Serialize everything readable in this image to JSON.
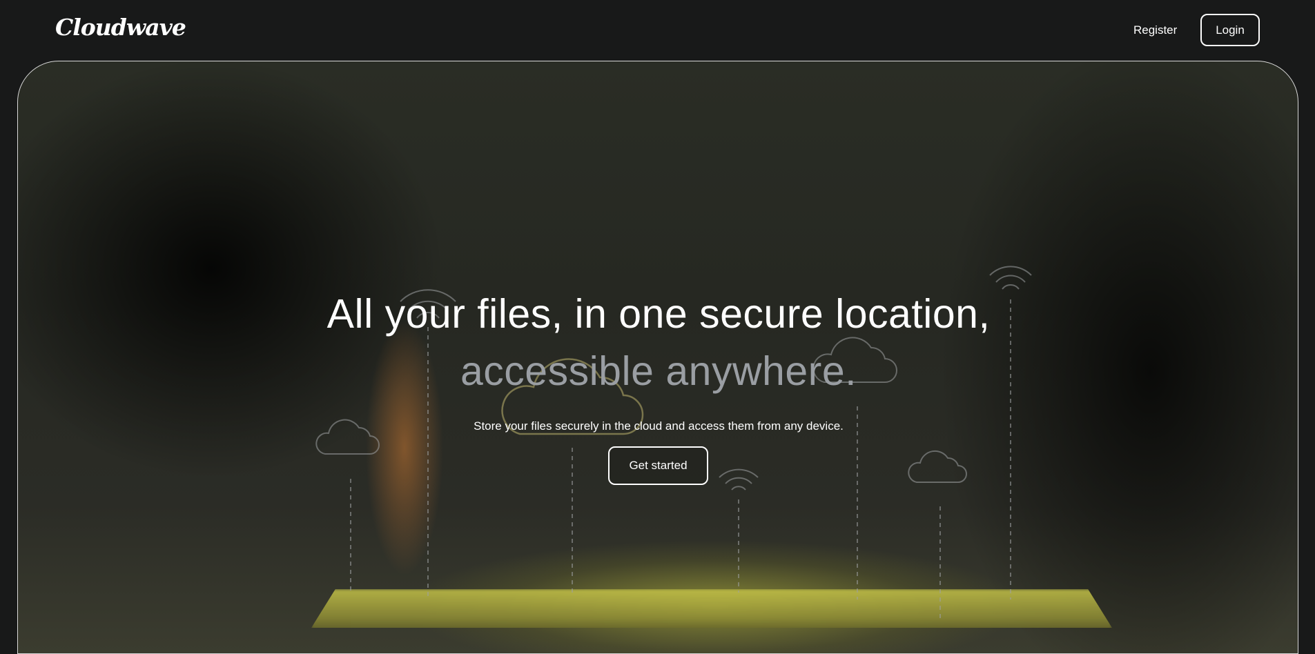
{
  "header": {
    "logo": "Cloudwave",
    "register_label": "Register",
    "login_label": "Login"
  },
  "hero": {
    "headline_line1": "All your files, in one secure location,",
    "headline_line2": "accessible anywhere.",
    "subtitle": "Store your files securely in the cloud and access them from any device.",
    "cta_label": "Get started"
  },
  "colors": {
    "background": "#181919",
    "text_primary": "#ffffff",
    "text_muted": "#9a9ea3",
    "border": "#d9d9d9"
  }
}
